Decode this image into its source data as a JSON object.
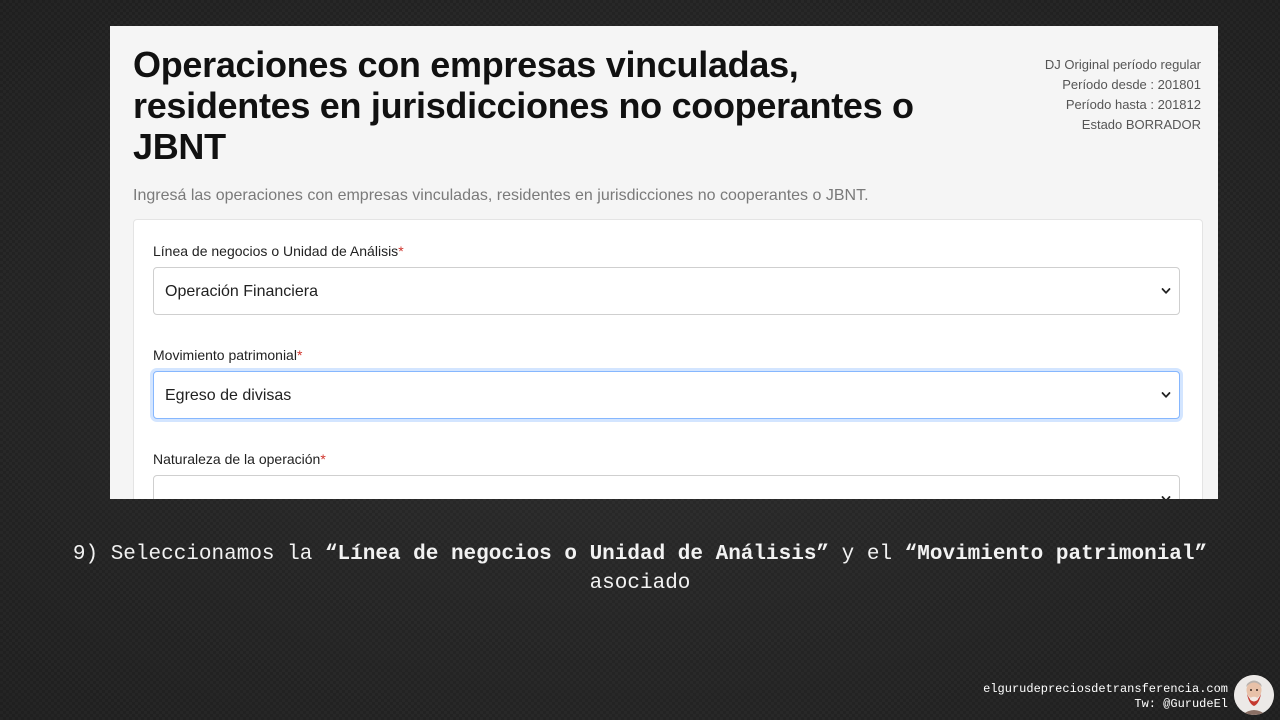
{
  "screenshot": {
    "title": "Operaciones con empresas vinculadas, residentes en jurisdicciones no cooperantes o JBNT",
    "meta": {
      "line1": "DJ Original período regular",
      "line2": "Período desde : 201801",
      "line3": "Período hasta : 201812",
      "line4": "Estado BORRADOR"
    },
    "subtitle": "Ingresá las operaciones con empresas vinculadas, residentes en jurisdicciones no cooperantes o JBNT.",
    "required_mark": "*",
    "fields": [
      {
        "label": "Línea de negocios o Unidad de Análisis",
        "value": "Operación Financiera"
      },
      {
        "label": "Movimiento patrimonial",
        "value": "Egreso de divisas"
      },
      {
        "label": "Naturaleza de la operación",
        "value": ""
      }
    ]
  },
  "caption": {
    "prefix": "9) Seleccionamos la ",
    "bold1": "“Línea de negocios o Unidad de Análisis”",
    "middle": " y el ",
    "bold2": "“Movimiento patrimonial”",
    "suffix": " asociado"
  },
  "footer": {
    "website": "elgurudepreciosdetransferencia.com",
    "twitter": "Tw: @GurudeEl"
  },
  "colors": {
    "required": "#d0342c",
    "focus_border": "#86b7fe",
    "background": "#262626"
  },
  "icons": {
    "select_arrow": "chevron-down-icon",
    "avatar": "avatar-illustration"
  }
}
